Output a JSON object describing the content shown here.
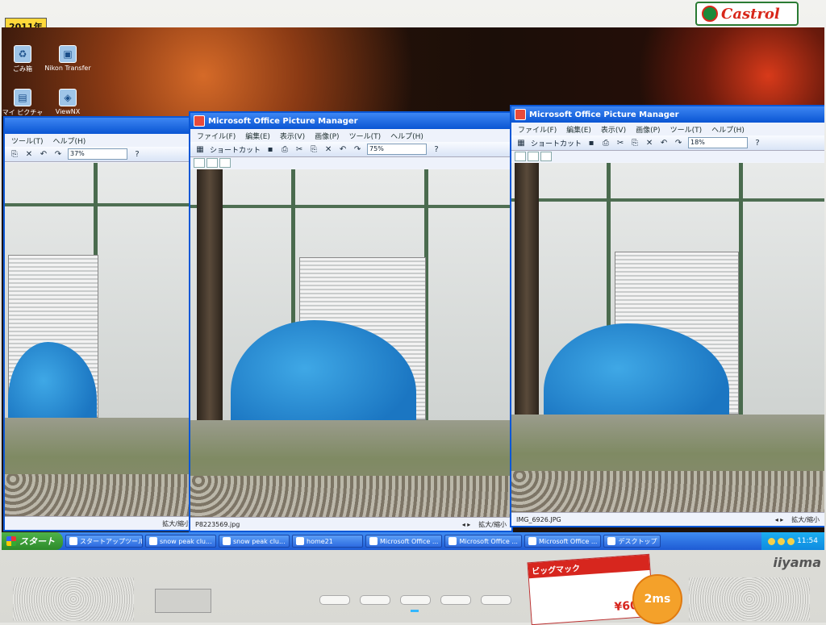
{
  "bezel": {
    "sticker_year": "2011年",
    "brand_logo": "Castrol",
    "monitor_brand": "iiyama",
    "badge_text": "",
    "mc_sticker": {
      "title": "ビッグマック",
      "price": "¥600",
      "circle_text": "2ms"
    }
  },
  "desktop": {
    "icons": [
      {
        "label": "ごみ箱",
        "icon": "recycle-bin-icon"
      },
      {
        "label": "Nikon Transfer",
        "icon": "nikon-transfer-icon"
      },
      {
        "label": "マイ ピクチャ",
        "icon": "folder-icon"
      },
      {
        "label": "ViewNX",
        "icon": "viewnx-icon"
      }
    ]
  },
  "windows": [
    {
      "title": "",
      "menu": [
        "ツール(T)",
        "ヘルプ(H)"
      ],
      "zoom": "37%",
      "filename": "",
      "status_right": "拡大/縮小"
    },
    {
      "title": "Microsoft Office Picture Manager",
      "menu": [
        "ファイル(F)",
        "編集(E)",
        "表示(V)",
        "画像(P)",
        "ツール(T)",
        "ヘルプ(H)"
      ],
      "shortcut_label": "ショートカット",
      "zoom": "75%",
      "filename": "P8223569.jpg",
      "status_right": "拡大/縮小"
    },
    {
      "title": "Microsoft Office Picture Manager",
      "menu": [
        "ファイル(F)",
        "編集(E)",
        "表示(V)",
        "画像(P)",
        "ツール(T)",
        "ヘルプ(H)"
      ],
      "shortcut_label": "ショートカット",
      "zoom": "18%",
      "filename": "IMG_6926.JPG",
      "status_right": "拡大/縮小"
    }
  ],
  "taskbar": {
    "start_label": "スタート",
    "tasks": [
      "スタートアップツール",
      "snow peak clu...",
      "snow peak clu...",
      "home21",
      "Microsoft Office ...",
      "Microsoft Office ...",
      "Microsoft Office ...",
      "デスクトップ"
    ],
    "clock": "11:54"
  }
}
